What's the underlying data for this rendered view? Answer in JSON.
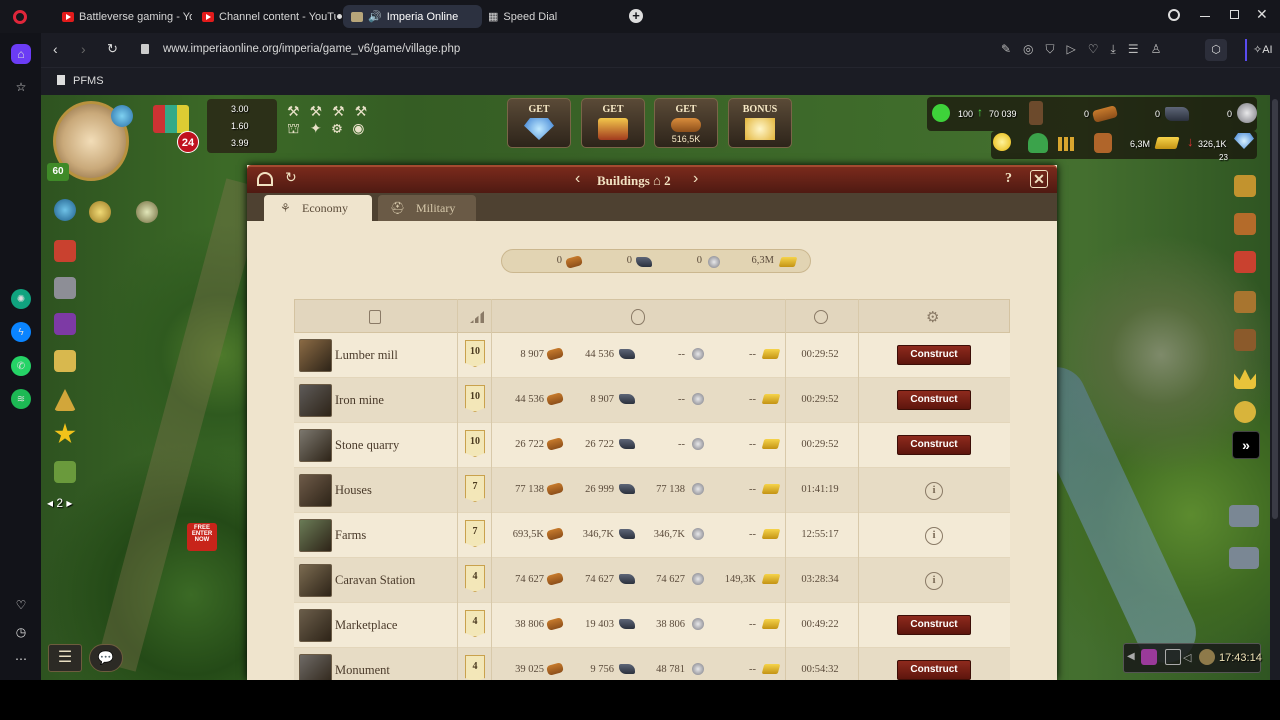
{
  "browser": {
    "tabs": [
      {
        "label": "Battleverse gaming - YouT",
        "type": "youtube"
      },
      {
        "label": "Channel content - YouTub",
        "type": "youtube"
      },
      {
        "label": "Imperia Online",
        "type": "game"
      },
      {
        "label": "Speed Dial",
        "type": "speeddial"
      }
    ],
    "url": "www.imperiaonline.org/imperia/game_v6/game/village.php",
    "bookmark": "PFMS",
    "ai_label": "AI"
  },
  "game": {
    "player_level": "60",
    "notif_count": "24",
    "production": [
      "3.00",
      "1.60",
      "3.99"
    ],
    "left_page": "2",
    "free_badge": "FREE",
    "enter_badge": "ENTER NOW",
    "get_buttons": [
      {
        "label": "GET",
        "sub": ""
      },
      {
        "label": "GET",
        "sub": ""
      },
      {
        "label": "GET",
        "sub": "516,5K"
      },
      {
        "label": "BONUS",
        "sub": ""
      }
    ],
    "top_stats": {
      "happiness": "100",
      "population": "70 039",
      "wood": "0",
      "iron": "0",
      "stone": "0"
    },
    "res_stats": {
      "gold_storage": "6,3M",
      "gold_income": "326,1K",
      "diamonds": "23"
    },
    "clock": "17:43:14"
  },
  "dialog": {
    "title": "Buildings",
    "page": "2",
    "tabs": [
      "Economy",
      "Military"
    ],
    "resources": {
      "wood": "0",
      "iron": "0",
      "stone": "0",
      "gold": "6,3M"
    },
    "construct_label": "Construct",
    "rows": [
      {
        "name": "Lumber mill",
        "level": "10",
        "wood": "8 907",
        "iron": "44 536",
        "stone": "--",
        "gold": "--",
        "time": "00:29:52",
        "action": "construct"
      },
      {
        "name": "Iron mine",
        "level": "10",
        "wood": "44 536",
        "iron": "8 907",
        "stone": "--",
        "gold": "--",
        "time": "00:29:52",
        "action": "construct"
      },
      {
        "name": "Stone quarry",
        "level": "10",
        "wood": "26 722",
        "iron": "26 722",
        "stone": "--",
        "gold": "--",
        "time": "00:29:52",
        "action": "construct"
      },
      {
        "name": "Houses",
        "level": "7",
        "wood": "77 138",
        "iron": "26 999",
        "stone": "77 138",
        "gold": "--",
        "time": "01:41:19",
        "action": "info"
      },
      {
        "name": "Farms",
        "level": "7",
        "wood": "693,5K",
        "iron": "346,7K",
        "stone": "346,7K",
        "gold": "--",
        "time": "12:55:17",
        "action": "info"
      },
      {
        "name": "Caravan Station",
        "level": "4",
        "wood": "74 627",
        "iron": "74 627",
        "stone": "74 627",
        "gold": "149,3K",
        "time": "03:28:34",
        "action": "info"
      },
      {
        "name": "Marketplace",
        "level": "4",
        "wood": "38 806",
        "iron": "19 403",
        "stone": "38 806",
        "gold": "--",
        "time": "00:49:22",
        "action": "construct"
      },
      {
        "name": "Monument",
        "level": "4",
        "wood": "39 025",
        "iron": "9 756",
        "stone": "48 781",
        "gold": "--",
        "time": "00:54:32",
        "action": "construct"
      }
    ]
  },
  "colors": {
    "accent": "#7a2a1c",
    "parchment": "#efe4cd",
    "construct": "#8e2a1d"
  }
}
